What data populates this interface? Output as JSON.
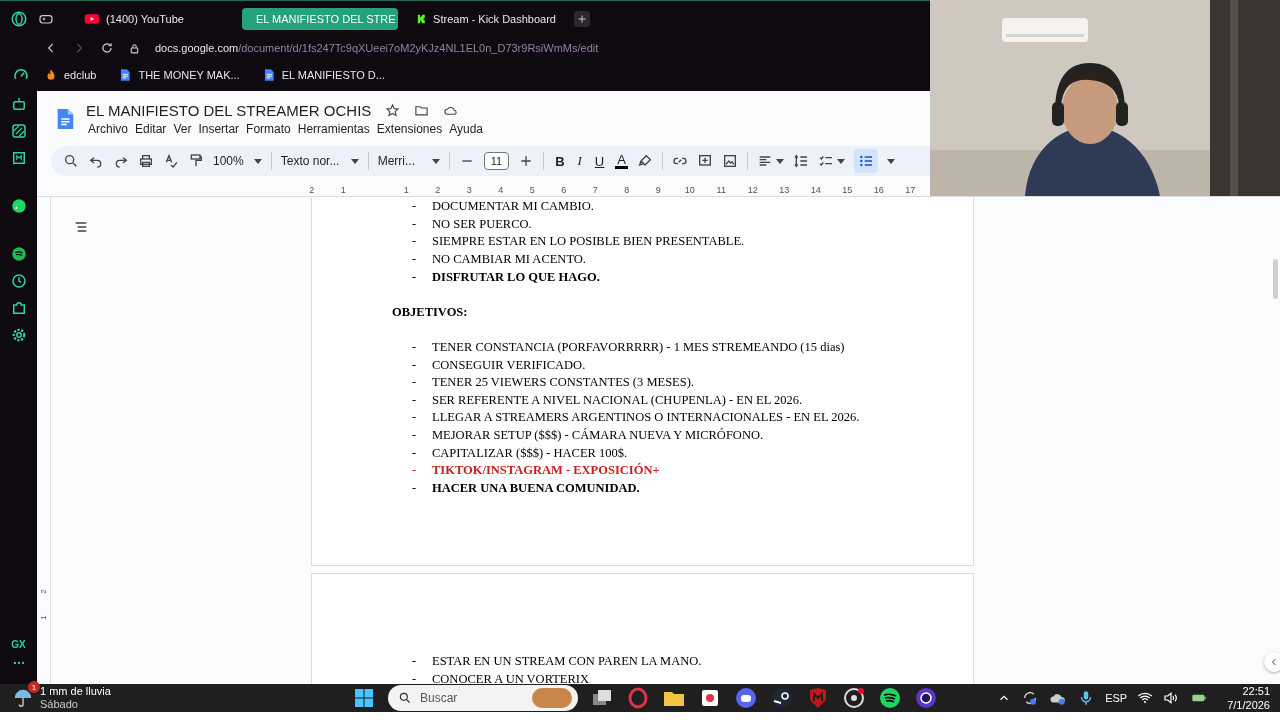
{
  "browser": {
    "tabs": [
      {
        "label": "(1400) YouTube",
        "kind": "youtube",
        "selected": false
      },
      {
        "label": "EL MANIFIESTO DEL STRE",
        "kind": "docs",
        "selected": true
      },
      {
        "label": "Stream - Kick Dashboard",
        "kind": "kick",
        "selected": false
      }
    ],
    "address": {
      "host": "docs.google.com",
      "path": "/document/d/1fs247Tc9qXUeei7oM2yKJz4NL1EL0n_D73r9RsiWmMs/edit"
    },
    "bookmarks": [
      {
        "label": "edclub",
        "kind": "flame"
      },
      {
        "label": "THE MONEY MAK...",
        "kind": "docs"
      },
      {
        "label": "EL MANIFIESTO D...",
        "kind": "docs"
      }
    ],
    "sidebar": {
      "badge": "GX"
    }
  },
  "docs": {
    "title": "EL MANIFIESTO DEL STREAMER OCHIS",
    "menu": [
      "Archivo",
      "Editar",
      "Ver",
      "Insertar",
      "Formato",
      "Herramientas",
      "Extensiones",
      "Ayuda"
    ],
    "toolbar": {
      "zoom": "100%",
      "style": "Texto nor...",
      "font": "Merri...",
      "font_size": "11",
      "format_buttons": [
        "B",
        "I",
        "U",
        "A"
      ],
      "bullet_list": {
        "selected": true
      }
    },
    "ruler": {
      "marks": [
        "2",
        "1",
        "1",
        "2",
        "3",
        "4",
        "5",
        "6",
        "7",
        "8",
        "9",
        "10",
        "11",
        "12",
        "13",
        "14",
        "15",
        "16",
        "17"
      ]
    },
    "vertical_ruler": {
      "marks": [
        "2",
        "1"
      ]
    },
    "pages": [
      {
        "lines": [
          {
            "kind": "bullet",
            "marker": "-",
            "text": "DOCUMENTAR MI CAMBIO.",
            "bold": false,
            "color": "#000000"
          },
          {
            "kind": "bullet",
            "marker": "-",
            "text": "NO SER PUERCO.",
            "bold": false,
            "color": "#000000"
          },
          {
            "kind": "bullet",
            "marker": "-",
            "text": "SIEMPRE ESTAR EN LO POSIBLE BIEN PRESENTABLE.",
            "bold": false,
            "color": "#000000"
          },
          {
            "kind": "bullet",
            "marker": "-",
            "text": "NO CAMBIAR MI ACENTO.",
            "bold": false,
            "color": "#000000"
          },
          {
            "kind": "bullet",
            "marker": "-",
            "text": "DISFRUTAR LO QUE HAGO.",
            "bold": true,
            "color": "#000000"
          },
          {
            "kind": "heading",
            "text": "OBJETIVOS:",
            "bold": true,
            "color": "#000000"
          },
          {
            "kind": "bullet",
            "marker": "-",
            "text": "TENER CONSTANCIA (PORFAVORRRRR) - 1 MES STREMEANDO (15 dias)",
            "bold": false,
            "color": "#000000"
          },
          {
            "kind": "bullet",
            "marker": "-",
            "text": "CONSEGUIR VERIFICADO.",
            "bold": false,
            "color": "#000000"
          },
          {
            "kind": "bullet",
            "marker": "-",
            "text": "TENER 25 VIEWERS CONSTANTES (3 MESES).",
            "bold": false,
            "color": "#000000"
          },
          {
            "kind": "bullet",
            "marker": "-",
            "text": "SER REFERENTE A NIVEL NACIONAL (CHUPENLA) - EN EL 2026.",
            "bold": false,
            "color": "#000000"
          },
          {
            "kind": "bullet",
            "marker": "-",
            "text": "LLEGAR A STREAMERS ARGENTINOS O INTERNACIONALES - EN EL 2026.",
            "bold": false,
            "color": "#000000"
          },
          {
            "kind": "bullet",
            "marker": "-",
            "text": "MEJORAR SETUP ($$$) - CÁMARA NUEVA Y MICRÓFONO.",
            "bold": false,
            "color": "#000000"
          },
          {
            "kind": "bullet",
            "marker": "-",
            "text": "CAPITALIZAR ($$$) - HACER 100$.",
            "bold": false,
            "color": "#000000"
          },
          {
            "kind": "bullet",
            "marker": "-",
            "text": "TIKTOK/INSTAGRAM - EXPOSICIÓN+",
            "bold": true,
            "color": "#c5221f"
          },
          {
            "kind": "bullet",
            "marker": "-",
            "text": "HACER UNA BUENA COMUNIDAD.",
            "bold": true,
            "color": "#000000"
          }
        ]
      },
      {
        "lines": [
          {
            "kind": "bullet",
            "marker": "-",
            "text": "ESTAR EN UN STREAM CON PAREN LA MANO.",
            "bold": false,
            "color": "#000000"
          },
          {
            "kind": "bullet",
            "marker": "-",
            "text": "CONOCER A UN VORTERIX",
            "bold": false,
            "color": "#000000"
          }
        ]
      }
    ]
  },
  "taskbar": {
    "weather": {
      "text": "1 mm de lluvia",
      "day": "Sábado",
      "badge": "1"
    },
    "search": {
      "placeholder": "Buscar"
    },
    "language": "ESP",
    "time": "22:51",
    "date": "7/1/2026"
  }
}
